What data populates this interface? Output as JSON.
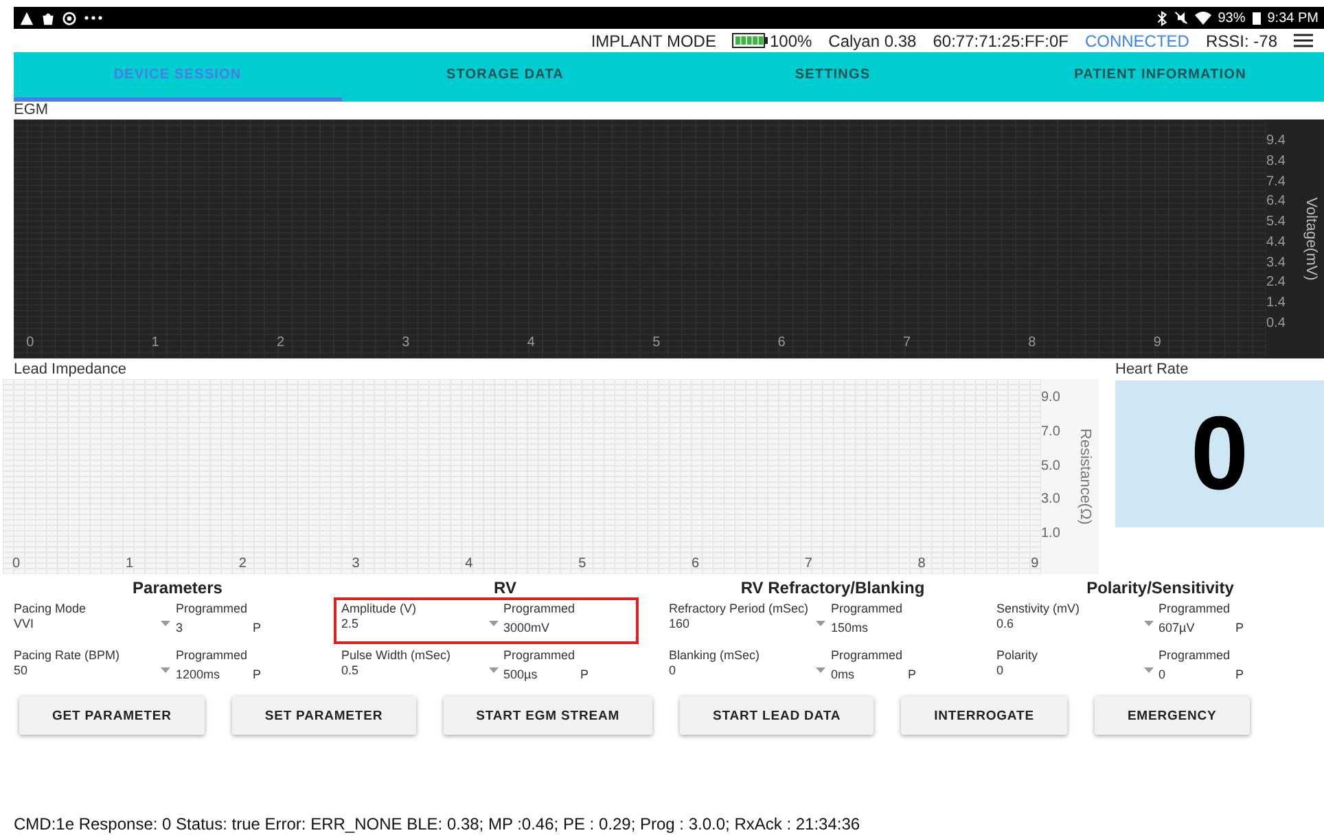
{
  "status_bar": {
    "time": "9:34 PM",
    "battery": "93%"
  },
  "info_bar": {
    "mode": "IMPLANT MODE",
    "battery": "100%",
    "version": "Calyan 0.38",
    "address": "60:77:71:25:FF:0F",
    "connection": "CONNECTED",
    "rssi": "RSSI: -78"
  },
  "tabs": [
    {
      "label": "DEVICE SESSION",
      "selected": true
    },
    {
      "label": "STORAGE DATA",
      "selected": false
    },
    {
      "label": "SETTINGS",
      "selected": false
    },
    {
      "label": "PATIENT INFORMATION",
      "selected": false
    }
  ],
  "egm": {
    "title": "EGM",
    "y_axis_title": "Voltage(mV)",
    "x_ticks": [
      "0",
      "1",
      "2",
      "3",
      "4",
      "5",
      "6",
      "7",
      "8",
      "9"
    ],
    "y_ticks": [
      "9.4",
      "8.4",
      "7.4",
      "6.4",
      "5.4",
      "4.4",
      "3.4",
      "2.4",
      "1.4",
      "0.4"
    ]
  },
  "lead_impedance": {
    "title": "Lead Impedance",
    "y_axis_title": "Resistance(Ω)",
    "x_ticks": [
      "0",
      "1",
      "2",
      "3",
      "4",
      "5",
      "6",
      "7",
      "8",
      "9"
    ],
    "y_ticks": [
      "9.0",
      "7.0",
      "5.0",
      "3.0",
      "1.0"
    ]
  },
  "heart_rate": {
    "title": "Heart Rate",
    "value": "0"
  },
  "sections": [
    {
      "title": "Parameters",
      "rows": [
        {
          "label": "Pacing Mode",
          "value": "VVI",
          "programmed_label": "Programmed",
          "programmed_value": "3",
          "flag": "P",
          "highlighted": false
        },
        {
          "label": "Pacing Rate (BPM)",
          "value": "50",
          "programmed_label": "Programmed",
          "programmed_value": "1200ms",
          "flag": "P",
          "highlighted": false
        }
      ]
    },
    {
      "title": "RV",
      "rows": [
        {
          "label": "Amplitude (V)",
          "value": "2.5",
          "programmed_label": "Programmed",
          "programmed_value": "3000mV",
          "highlighted": true
        },
        {
          "label": "Pulse Width (mSec)",
          "value": "0.5",
          "programmed_label": "Programmed",
          "programmed_value": "500µs",
          "flag": "P",
          "highlighted": false
        }
      ]
    },
    {
      "title": "RV Refractory/Blanking",
      "rows": [
        {
          "label": "Refractory Period (mSec)",
          "value": "160",
          "programmed_label": "Programmed",
          "programmed_value": "150ms",
          "highlighted": false
        },
        {
          "label": "Blanking (mSec)",
          "value": "0",
          "programmed_label": "Programmed",
          "programmed_value": "0ms",
          "flag": "P",
          "highlighted": false
        }
      ]
    },
    {
      "title": "Polarity/Sensitivity",
      "rows": [
        {
          "label": "Senstivity (mV)",
          "value": "0.6",
          "programmed_label": "Programmed",
          "programmed_value": "607µV",
          "flag": "P",
          "highlighted": false
        },
        {
          "label": "Polarity",
          "value": "0",
          "programmed_label": "Programmed",
          "programmed_value": "0",
          "flag": "P",
          "highlighted": false
        }
      ]
    }
  ],
  "buttons": [
    "GET PARAMETER",
    "SET PARAMETER",
    "START EGM STREAM",
    "START LEAD DATA",
    "INTERROGATE",
    "EMERGENCY"
  ],
  "footer": "CMD:1e Response: 0 Status: true Error: ERR_NONE BLE: 0.38; MP :0.46; PE : 0.29; Prog : 3.0.0; RxAck : 21:34:36"
}
